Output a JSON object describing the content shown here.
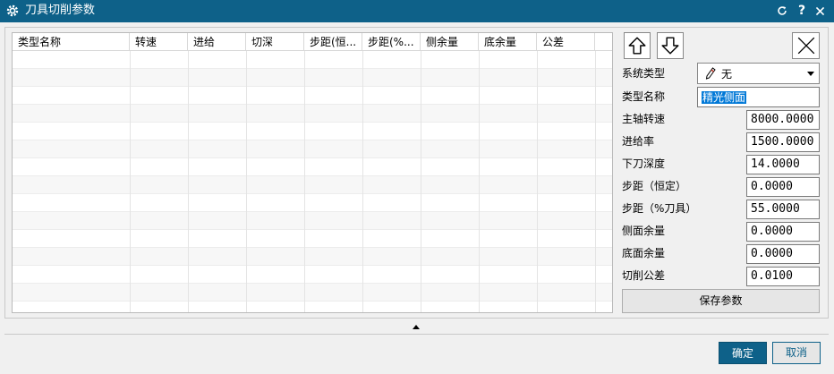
{
  "window": {
    "title": "刀具切削参数"
  },
  "table": {
    "columns": [
      "类型名称",
      "转速",
      "进给",
      "切深",
      "步距(恒...",
      "步距(%...",
      "侧余量",
      "底余量",
      "公差"
    ],
    "rows": []
  },
  "form": {
    "system_type_label": "系统类型",
    "system_type_value": "无",
    "type_name_label": "类型名称",
    "type_name_value": "精光侧面",
    "spindle_label": "主轴转速",
    "spindle_value": "8000.0000",
    "feed_label": "进给率",
    "feed_value": "1500.0000",
    "depth_label": "下刀深度",
    "depth_value": "14.0000",
    "step_const_label": "步距（恒定）",
    "step_const_value": "0.0000",
    "step_pct_label": "步距（%刀具）",
    "step_pct_value": "55.0000",
    "side_label": "侧面余量",
    "side_value": "0.0000",
    "bottom_label": "底面余量",
    "bottom_value": "0.0000",
    "tol_label": "切削公差",
    "tol_value": "0.0100",
    "save_label": "保存参数"
  },
  "footer": {
    "ok_label": "确定",
    "cancel_label": "取消"
  },
  "colors": {
    "accent": "#0e6189"
  }
}
